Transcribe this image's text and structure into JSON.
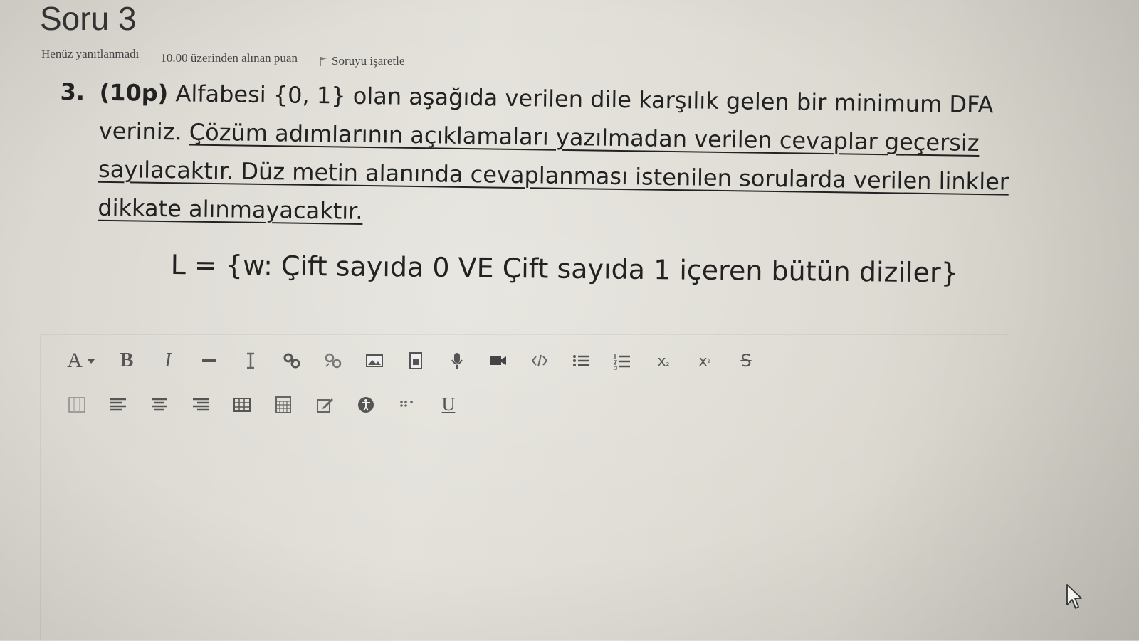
{
  "question": {
    "heading": "Soru 3",
    "status": "Henüz yanıtlanmadı",
    "points_label": "10.00 üzerinden alınan puan",
    "flag_label": "Soruyu işaretle",
    "number": "3.",
    "points": "(10p)",
    "text_plain": "Alfabesi {0, 1} olan aşağıda verilen dile karşılık gelen bir minimum DFA veriniz.",
    "text_underlined": "Çözüm adımlarının açıklamaları yazılmadan verilen cevaplar geçersiz sayılacaktır. Düz metin alanında cevaplanması istenilen sorularda verilen linkler dikkate alınmayacaktır.",
    "formula": "L = {w: Çift sayıda 0 VE Çift sayıda 1 içeren bütün diziler}"
  },
  "toolbar": {
    "row1": [
      {
        "icon": "font-family-icon",
        "glyph": "A"
      },
      {
        "icon": "bold-icon",
        "glyph": "B"
      },
      {
        "icon": "italic-icon",
        "glyph": "I"
      },
      {
        "icon": "horizontal-rule-icon",
        "glyph": ""
      },
      {
        "icon": "text-cursor-icon",
        "glyph": ""
      },
      {
        "icon": "link-icon",
        "glyph": ""
      },
      {
        "icon": "unlink-icon",
        "glyph": ""
      },
      {
        "icon": "image-icon",
        "glyph": ""
      },
      {
        "icon": "media-icon",
        "glyph": ""
      },
      {
        "icon": "microphone-icon",
        "glyph": ""
      },
      {
        "icon": "video-icon",
        "glyph": ""
      },
      {
        "icon": "code-icon",
        "glyph": ""
      },
      {
        "icon": "bullet-list-icon",
        "glyph": ""
      },
      {
        "icon": "numbered-list-icon",
        "glyph": ""
      },
      {
        "icon": "subscript-icon",
        "glyph": "x2"
      },
      {
        "icon": "superscript-icon",
        "glyph": "x2"
      },
      {
        "icon": "strikethrough-icon",
        "glyph": "S"
      }
    ],
    "row2": [
      {
        "icon": "block-icon",
        "glyph": ""
      },
      {
        "icon": "align-left-icon",
        "glyph": ""
      },
      {
        "icon": "align-center-icon",
        "glyph": ""
      },
      {
        "icon": "align-right-icon",
        "glyph": ""
      },
      {
        "icon": "table-icon",
        "glyph": ""
      },
      {
        "icon": "table-edit-icon",
        "glyph": ""
      },
      {
        "icon": "edit-icon",
        "glyph": ""
      },
      {
        "icon": "accessibility-icon",
        "glyph": ""
      },
      {
        "icon": "special-chars-icon",
        "glyph": ""
      },
      {
        "icon": "underline-icon",
        "glyph": "U"
      }
    ]
  },
  "editor": {
    "value": ""
  }
}
